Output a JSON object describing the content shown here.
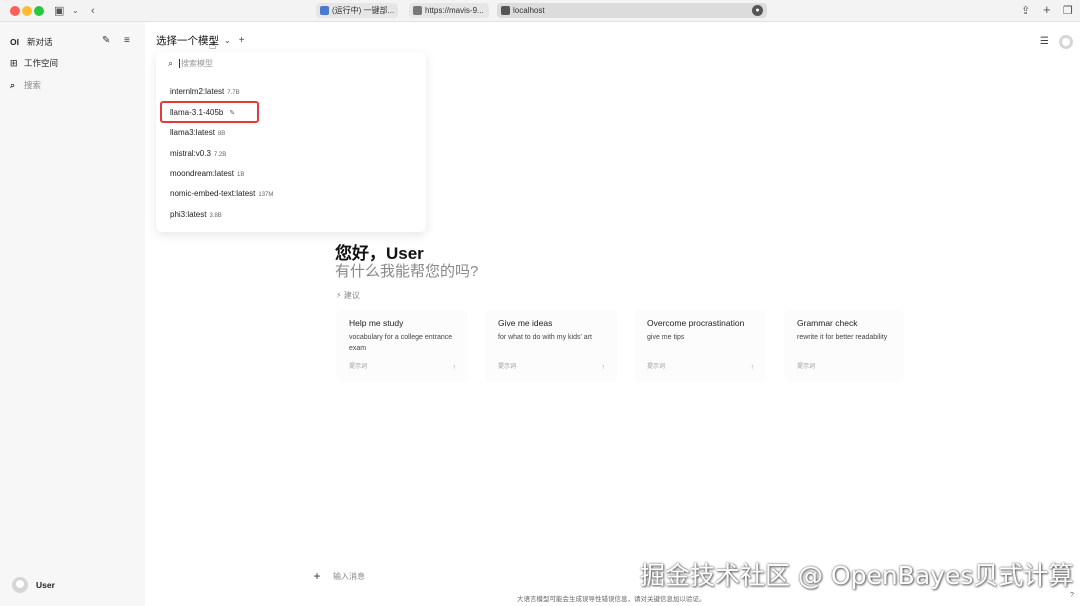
{
  "browser": {
    "tabs": [
      {
        "label": "(运行中) 一键部..."
      },
      {
        "label": "https://mavis-9..."
      },
      {
        "label": "localhost"
      }
    ]
  },
  "sidebar": {
    "logo": "OI",
    "new_chat": "新对话",
    "workspace": "工作空间",
    "search": "搜索",
    "user": "User"
  },
  "header": {
    "model_select": "选择一个模型"
  },
  "dropdown": {
    "search_placeholder": "搜索模型",
    "models": [
      {
        "name": "internlm2:latest",
        "size": "7.7B"
      },
      {
        "name": "llama-3.1-405b",
        "size": ""
      },
      {
        "name": "llama3:latest",
        "size": "8B"
      },
      {
        "name": "mistral:v0.3",
        "size": "7.2B"
      },
      {
        "name": "moondream:latest",
        "size": "1B"
      },
      {
        "name": "nomic-embed-text:latest",
        "size": "137M"
      },
      {
        "name": "phi3:latest",
        "size": "3.8B"
      }
    ]
  },
  "main": {
    "greeting": "您好，User",
    "subtitle": "有什么我能帮您的吗?",
    "suggest_label": "建议",
    "cards": [
      {
        "title": "Help me study",
        "desc": "vocabulary for a college entrance exam",
        "footer": "提示词"
      },
      {
        "title": "Give me ideas",
        "desc": "for what to do with my kids' art",
        "footer": "提示词"
      },
      {
        "title": "Overcome procrastination",
        "desc": "give me tips",
        "footer": "提示词"
      },
      {
        "title": "Grammar check",
        "desc": "rewrite it for better readability",
        "footer": "提示词"
      }
    ]
  },
  "input": {
    "placeholder": "输入消息"
  },
  "footer": {
    "disclaimer": "大语言模型可能会生成误导性错误信息，请对关键信息加以验证。",
    "help": "?"
  },
  "watermark": "掘金技术社区 @ OpenBayes贝式计算",
  "colors": {
    "highlight": "#e53935",
    "sidebar_bg": "#f7f7f7"
  }
}
